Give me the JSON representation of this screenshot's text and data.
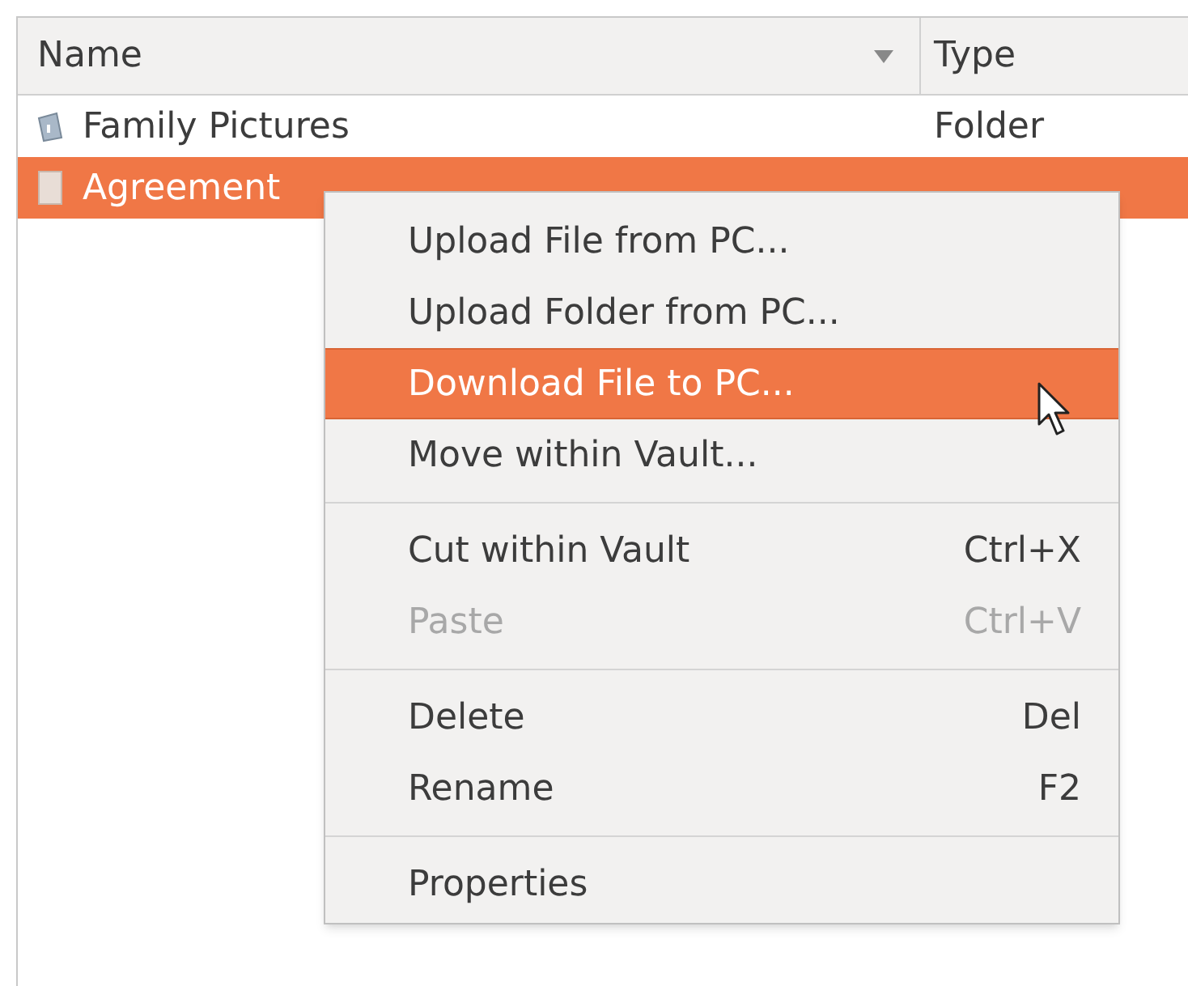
{
  "table": {
    "columns": [
      {
        "label": "Name",
        "sorted": true
      },
      {
        "label": "Type"
      }
    ],
    "rows": [
      {
        "kind": "folder",
        "name": "Family Pictures",
        "type": "Folder",
        "selected": false
      },
      {
        "kind": "file",
        "name": "Agreement",
        "selected": true
      }
    ]
  },
  "context_menu": {
    "items": [
      {
        "kind": "item",
        "label": "Upload File from PC...",
        "selected": false,
        "disabled": false
      },
      {
        "kind": "item",
        "label": "Upload Folder from PC...",
        "selected": false,
        "disabled": false
      },
      {
        "kind": "item",
        "label": "Download File to PC...",
        "selected": true,
        "disabled": false
      },
      {
        "kind": "item",
        "label": "Move within Vault...",
        "selected": false,
        "disabled": false
      },
      {
        "kind": "separator"
      },
      {
        "kind": "item",
        "label": "Cut within Vault",
        "shortcut": "Ctrl+X",
        "selected": false,
        "disabled": false
      },
      {
        "kind": "item",
        "label": "Paste",
        "shortcut": "Ctrl+V",
        "selected": false,
        "disabled": true
      },
      {
        "kind": "separator"
      },
      {
        "kind": "item",
        "label": "Delete",
        "shortcut": "Del",
        "selected": false,
        "disabled": false
      },
      {
        "kind": "item",
        "label": "Rename",
        "shortcut": "F2",
        "selected": false,
        "disabled": false
      },
      {
        "kind": "separator"
      },
      {
        "kind": "item",
        "label": "Properties",
        "selected": false,
        "disabled": false
      }
    ]
  }
}
